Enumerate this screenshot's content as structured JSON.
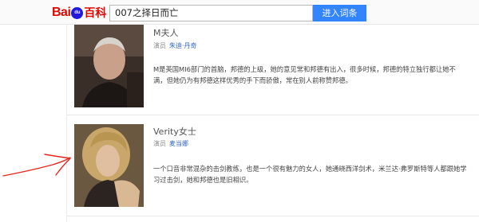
{
  "header": {
    "logo": {
      "part1": "Bai",
      "paw": "du",
      "part2": "百科"
    },
    "search": {
      "value": "007之择日而亡",
      "button": "进入词条"
    }
  },
  "roles": [
    {
      "name": "M夫人",
      "meta_label": "演员",
      "actor": "朱迪·丹奇",
      "description": "M是英国MI6部门的首脑，邦德的上级，她的意见常和邦德有出入，很多时候，邦德的特立独行都让她不满，但她仍为有邦德这样优秀的手下而骄傲，常在别人前称赞邦德。"
    },
    {
      "name": "Verity女士",
      "meta_label": "演员",
      "actor": "麦当娜",
      "description": "一个口音非常混杂的击剑教练，也是一个很有魅力的女人，她通晓西洋剑术，米兰达·弗罗斯特等人都跟她学习过击剑，她和邦德也是旧相识。"
    }
  ],
  "colors": {
    "brand_red": "#e10601",
    "brand_blue": "#2319dc",
    "button_blue": "#3385ff",
    "link_blue": "#3366cc",
    "annotation_red": "#e8261c"
  }
}
